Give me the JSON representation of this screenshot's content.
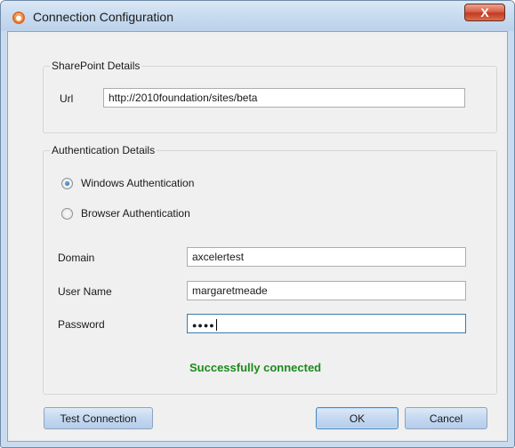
{
  "window": {
    "title": "Connection Configuration",
    "close_glyph": "X"
  },
  "sharepoint": {
    "legend": "SharePoint Details",
    "url_label": "Url",
    "url_value": "http://2010foundation/sites/beta"
  },
  "auth": {
    "legend": "Authentication Details",
    "options": [
      {
        "label": "Windows Authentication",
        "checked": true
      },
      {
        "label": "Browser Authentication",
        "checked": false
      }
    ],
    "domain_label": "Domain",
    "domain_value": "axcelertest",
    "username_label": "User Name",
    "username_value": "margaretmeade",
    "password_label": "Password",
    "password_mask": "●●●●",
    "status": "Successfully connected",
    "status_color": "#1c8a1c"
  },
  "buttons": {
    "test": "Test Connection",
    "ok": "OK",
    "cancel": "Cancel"
  },
  "icons": {
    "app": "app-logo-icon",
    "close": "close-icon"
  }
}
